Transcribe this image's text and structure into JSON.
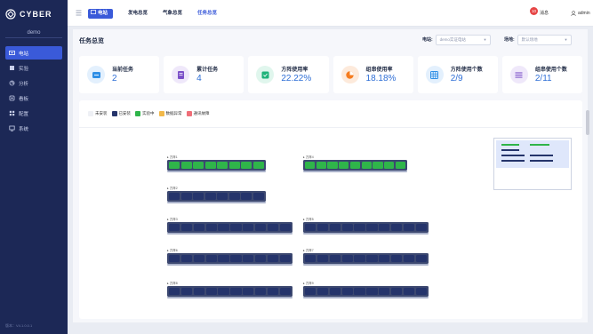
{
  "app": {
    "logo_text": "CYBER",
    "tenant": "demo",
    "version": "版本：V4.1.0.0.1"
  },
  "sidebar": {
    "items": [
      {
        "label": "电站",
        "icon": "station-icon",
        "active": true
      },
      {
        "label": "实验",
        "icon": "experiment-icon",
        "active": false
      },
      {
        "label": "分析",
        "icon": "analysis-icon",
        "active": false
      },
      {
        "label": "看板",
        "icon": "dashboard-icon",
        "active": false
      },
      {
        "label": "配置",
        "icon": "config-icon",
        "active": false
      },
      {
        "label": "系统",
        "icon": "system-icon",
        "active": false
      }
    ]
  },
  "topbar": {
    "tabs": [
      {
        "label": "电站"
      },
      {
        "label": "发电总览"
      },
      {
        "label": "气象总览"
      },
      {
        "label": "任务总览"
      }
    ],
    "notification_count": "10",
    "notification_label": "消息",
    "user": "admin"
  },
  "main": {
    "title": "任务总览",
    "filters": [
      {
        "label": "电站:",
        "value": "demo实证电站"
      },
      {
        "label": "场地:",
        "value": "默认场地"
      }
    ],
    "cards": [
      {
        "label": "当前任务",
        "value": "2",
        "icon": "current-task-icon",
        "color": "#2f8fe6"
      },
      {
        "label": "累计任务",
        "value": "4",
        "icon": "cumulative-task-icon",
        "color": "#7b4fc8"
      },
      {
        "label": "方阵使用率",
        "value": "22.22%",
        "icon": "array-usage-icon",
        "color": "#1fb37a"
      },
      {
        "label": "组串使用率",
        "value": "18.18%",
        "icon": "string-usage-icon",
        "color": "#f57c1f"
      },
      {
        "label": "方阵使用个数",
        "value": "2/9",
        "icon": "array-count-icon",
        "color": "#2f8fe6"
      },
      {
        "label": "组串使用个数",
        "value": "2/11",
        "icon": "string-count-icon",
        "color": "#7b4fc8"
      }
    ],
    "legend": [
      {
        "label": "未安装",
        "color": "#eef0f5"
      },
      {
        "label": "已安装",
        "color": "#25346b"
      },
      {
        "label": "实验中",
        "color": "#2fb54a"
      },
      {
        "label": "数据异常",
        "color": "#f2b94a"
      },
      {
        "label": "通讯故障",
        "color": "#ef6e78"
      }
    ],
    "racks": [
      {
        "label": "▸ 方阵1",
        "status": "testing"
      },
      {
        "label": "▸ 方阵2",
        "status": "installed"
      },
      {
        "label": "▸ 方阵3",
        "status": "installed"
      },
      {
        "label": "▸ 方阵4",
        "status": "testing"
      },
      {
        "label": "▸ 方阵5",
        "status": "installed"
      },
      {
        "label": "▸ 方阵6",
        "status": "installed"
      },
      {
        "label": "▸ 方阵7",
        "status": "installed"
      },
      {
        "label": "▸ 方阵8",
        "status": "installed"
      },
      {
        "label": "▸ 方阵9",
        "status": "installed"
      },
      {
        "label": "▸ 方阵10",
        "status": "installed"
      }
    ]
  }
}
